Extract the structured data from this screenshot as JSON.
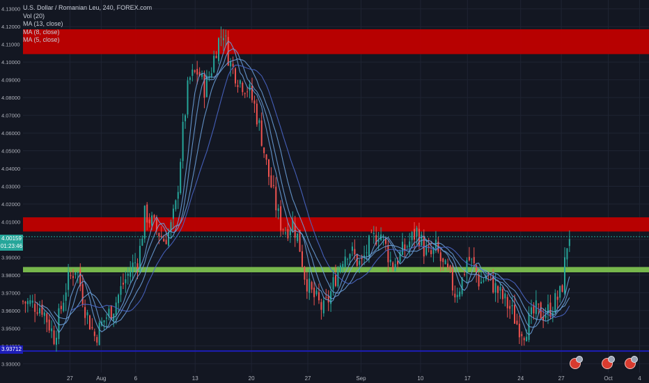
{
  "legend": {
    "symbol": "U.S. Dollar / Romanian Leu, 240, FOREX.com",
    "volume": "Vol (20)",
    "ma13": "MA (13, close)",
    "ma8": "MA (8, close)",
    "ma5": "MA (5, close)"
  },
  "price_labels": {
    "last_price": "4.00159",
    "countdown": "01:23:46",
    "blue_line": "3.93712"
  },
  "colors": {
    "background": "#131722",
    "up": "#26a69a",
    "down": "#ef5350",
    "ma": "#6a9fd8",
    "resistance_zone": "#c00000",
    "support_zone": "#7cc04f",
    "blue_line": "#1d1db8"
  },
  "chart_data": {
    "type": "candlestick",
    "title": "U.S. Dollar / Romanian Leu, 240, FOREX.com",
    "ylim": [
      3.925,
      4.135
    ],
    "y_ticks": [
      "4.13000",
      "4.12000",
      "4.11000",
      "4.10000",
      "4.09000",
      "4.08000",
      "4.07000",
      "4.06000",
      "4.05000",
      "4.04000",
      "4.03000",
      "4.02000",
      "4.01000",
      "4.00000",
      "3.99000",
      "3.98000",
      "3.97000",
      "3.96000",
      "3.95000",
      "3.94000",
      "3.93000"
    ],
    "x_ticks": [
      {
        "label": "27",
        "t": 0.075
      },
      {
        "label": "Aug",
        "t": 0.125
      },
      {
        "label": "6",
        "t": 0.18
      },
      {
        "label": "13",
        "t": 0.275
      },
      {
        "label": "20",
        "t": 0.365
      },
      {
        "label": "27",
        "t": 0.455
      },
      {
        "label": "Sep",
        "t": 0.54
      },
      {
        "label": "10",
        "t": 0.635
      },
      {
        "label": "17",
        "t": 0.71
      },
      {
        "label": "24",
        "t": 0.795
      },
      {
        "label": "27",
        "t": 0.86
      },
      {
        "label": "Oct",
        "t": 0.935
      },
      {
        "label": "4",
        "t": 0.985
      }
    ],
    "zones": [
      {
        "name": "resistance-top",
        "from": 4.1045,
        "to": 4.1185,
        "color": "#c00000"
      },
      {
        "name": "resistance-mid",
        "from": 4.0045,
        "to": 4.0125,
        "color": "#c00000"
      },
      {
        "name": "support",
        "from": 3.9815,
        "to": 3.9845,
        "color": "#7cc04f"
      }
    ],
    "horizontal_line": 3.93712,
    "last_price": 4.00159,
    "path": [
      [
        0.0,
        3.965
      ],
      [
        0.03,
        3.962
      ],
      [
        0.05,
        3.945
      ],
      [
        0.07,
        3.975
      ],
      [
        0.085,
        3.985
      ],
      [
        0.1,
        3.96
      ],
      [
        0.115,
        3.945
      ],
      [
        0.13,
        3.955
      ],
      [
        0.145,
        3.962
      ],
      [
        0.16,
        3.975
      ],
      [
        0.175,
        3.985
      ],
      [
        0.185,
        3.99
      ],
      [
        0.195,
        4.015
      ],
      [
        0.205,
        4.01
      ],
      [
        0.215,
        4.005
      ],
      [
        0.225,
        4.0
      ],
      [
        0.235,
        4.005
      ],
      [
        0.245,
        4.02
      ],
      [
        0.255,
        4.06
      ],
      [
        0.265,
        4.09
      ],
      [
        0.28,
        4.095
      ],
      [
        0.29,
        4.085
      ],
      [
        0.3,
        4.095
      ],
      [
        0.31,
        4.11
      ],
      [
        0.32,
        4.118
      ],
      [
        0.33,
        4.1
      ],
      [
        0.345,
        4.09
      ],
      [
        0.36,
        4.085
      ],
      [
        0.37,
        4.075
      ],
      [
        0.38,
        4.06
      ],
      [
        0.39,
        4.04
      ],
      [
        0.4,
        4.025
      ],
      [
        0.41,
        4.01
      ],
      [
        0.42,
        4.005
      ],
      [
        0.43,
        4.01
      ],
      [
        0.44,
        4.0
      ],
      [
        0.45,
        3.98
      ],
      [
        0.46,
        3.97
      ],
      [
        0.47,
        3.965
      ],
      [
        0.48,
        3.96
      ],
      [
        0.49,
        3.968
      ],
      [
        0.5,
        3.98
      ],
      [
        0.51,
        3.99
      ],
      [
        0.52,
        3.995
      ],
      [
        0.53,
        3.99
      ],
      [
        0.54,
        3.985
      ],
      [
        0.55,
        3.995
      ],
      [
        0.56,
        4.0
      ],
      [
        0.57,
        4.005
      ],
      [
        0.58,
        3.995
      ],
      [
        0.59,
        3.985
      ],
      [
        0.6,
        3.99
      ],
      [
        0.61,
        3.995
      ],
      [
        0.62,
        4.0
      ],
      [
        0.63,
        4.005
      ],
      [
        0.64,
        3.995
      ],
      [
        0.65,
        3.99
      ],
      [
        0.66,
        3.995
      ],
      [
        0.67,
        3.985
      ],
      [
        0.68,
        3.98
      ],
      [
        0.69,
        3.97
      ],
      [
        0.7,
        3.975
      ],
      [
        0.71,
        3.99
      ],
      [
        0.72,
        3.985
      ],
      [
        0.73,
        3.975
      ],
      [
        0.74,
        3.98
      ],
      [
        0.75,
        3.975
      ],
      [
        0.76,
        3.97
      ],
      [
        0.77,
        3.965
      ],
      [
        0.78,
        3.96
      ],
      [
        0.79,
        3.952
      ],
      [
        0.8,
        3.948
      ],
      [
        0.81,
        3.955
      ],
      [
        0.82,
        3.96
      ],
      [
        0.83,
        3.958
      ],
      [
        0.84,
        3.96
      ],
      [
        0.85,
        3.965
      ],
      [
        0.86,
        3.97
      ],
      [
        0.865,
        3.985
      ],
      [
        0.87,
        4.0
      ],
      [
        0.873,
        4.003
      ]
    ]
  }
}
